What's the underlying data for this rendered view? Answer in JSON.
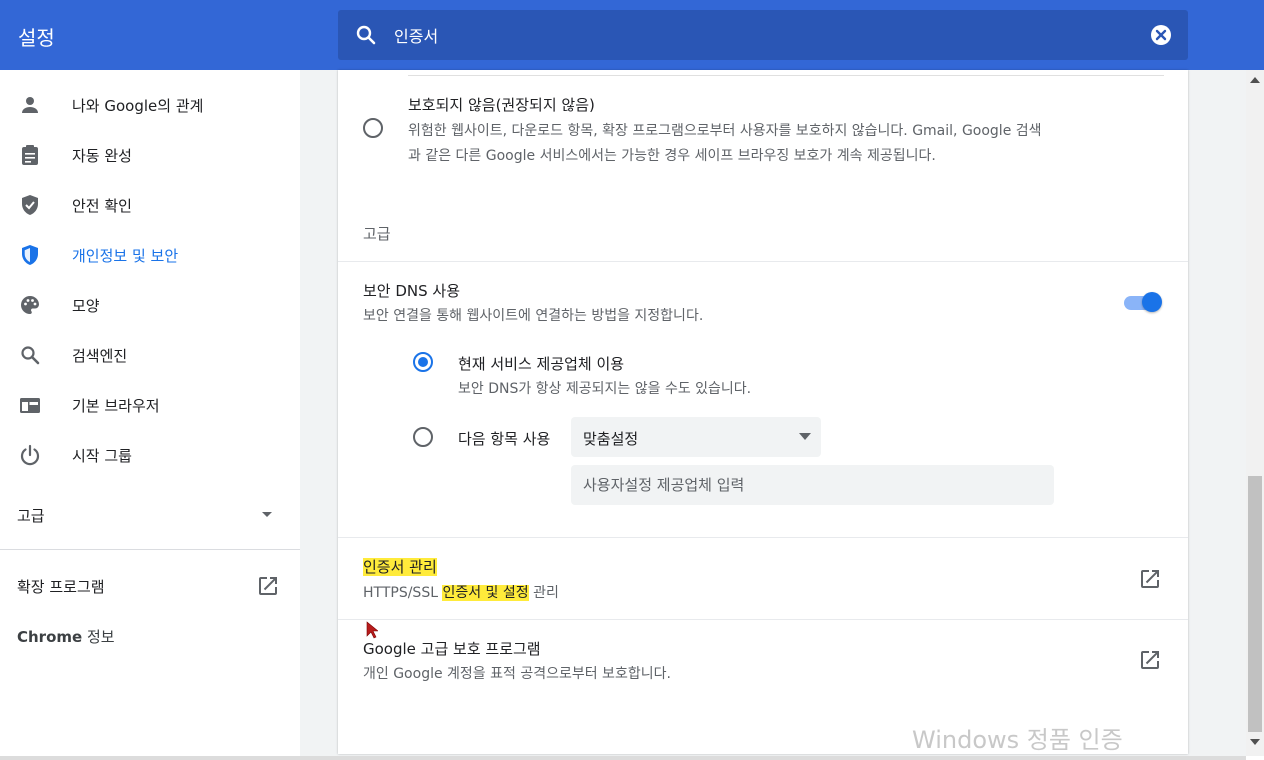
{
  "header": {
    "title": "설정",
    "search_value": "인증서"
  },
  "sidebar": {
    "items": [
      {
        "label": "나와 Google의 관계",
        "icon": "person-icon"
      },
      {
        "label": "자동 완성",
        "icon": "clipboard-icon"
      },
      {
        "label": "안전 확인",
        "icon": "shield-check-icon"
      },
      {
        "label": "개인정보 및 보안",
        "icon": "shield-icon",
        "active": true
      },
      {
        "label": "모양",
        "icon": "palette-icon"
      },
      {
        "label": "검색엔진",
        "icon": "search-icon"
      },
      {
        "label": "기본 브라우저",
        "icon": "browser-icon"
      },
      {
        "label": "시작 그룹",
        "icon": "power-icon"
      }
    ],
    "advanced_label": "고급",
    "extensions_label": "확장 프로그램",
    "about_brand": "Chrome",
    "about_label": " 정보"
  },
  "main": {
    "no_protection": {
      "title": "보호되지 않음(권장되지 않음)",
      "desc_line1": "위험한 웹사이트, 다운로드 항목, 확장 프로그램으로부터 사용자를 보호하지 않습니다. Gmail, Google 검색",
      "desc_line2": "과 같은 다른 Google 서비스에서는 가능한 경우 세이프 브라우징 보호가 계속 제공됩니다."
    },
    "advanced_heading": "고급",
    "secure_dns": {
      "title": "보안 DNS 사용",
      "desc": "보안 연결을 통해 웹사이트에 연결하는 방법을 지정합니다.",
      "enabled": true,
      "current_provider": {
        "title": "현재 서비스 제공업체 이용",
        "desc": "보안 DNS가 항상 제공되지는 않을 수도 있습니다."
      },
      "custom_label": "다음 항목 사용",
      "custom_select_value": "맞춤설정",
      "custom_input_placeholder": "사용자설정 제공업체 입력"
    },
    "cert_manage": {
      "title": "인증서 관리",
      "desc_prefix": "HTTPS/SSL ",
      "desc_highlight": "인증서 및 설정",
      "desc_suffix": " 관리"
    },
    "advanced_protection": {
      "title": "Google 고급 보호 프로그램",
      "desc": "개인 Google 계정을 표적 공격으로부터 보호합니다."
    }
  },
  "watermark": "Windows 정품 인증",
  "colors": {
    "header_bg": "#3367d6",
    "search_bg": "#2a56b5",
    "accent": "#1a73e8",
    "highlight": "#ffeb3b"
  }
}
